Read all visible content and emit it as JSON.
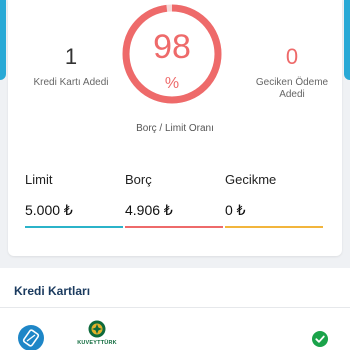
{
  "summary": {
    "credit_card_count": "1",
    "credit_card_label": "Kredi Kartı Adedi",
    "debt_ratio_value": "98",
    "debt_ratio_unit": "%",
    "debt_ratio_fraction": 0.98,
    "debt_ratio_caption": "Borç / Limit Oranı",
    "late_payment_count": "0",
    "late_payment_label": "Geciken Ödeme Adedi"
  },
  "metrics": {
    "limit": {
      "label": "Limit",
      "value": "5.000 ₺",
      "color": "#2bb3c9"
    },
    "debt": {
      "label": "Borç",
      "value": "4.906 ₺",
      "color": "#ee6a6a"
    },
    "late": {
      "label": "Gecikme",
      "value": "0 ₺",
      "color": "#f2b53c"
    }
  },
  "cards": {
    "title": "Kredi Kartları",
    "items": [
      {
        "icon": "bank-card-icon",
        "bank_logo_text": "KUVEYTTÜRK",
        "status": "check-icon"
      }
    ]
  },
  "colors": {
    "accent": "#29a9d6",
    "gauge": "#ee6a6a",
    "title": "#1a3a5e",
    "check": "#1aa34a"
  }
}
